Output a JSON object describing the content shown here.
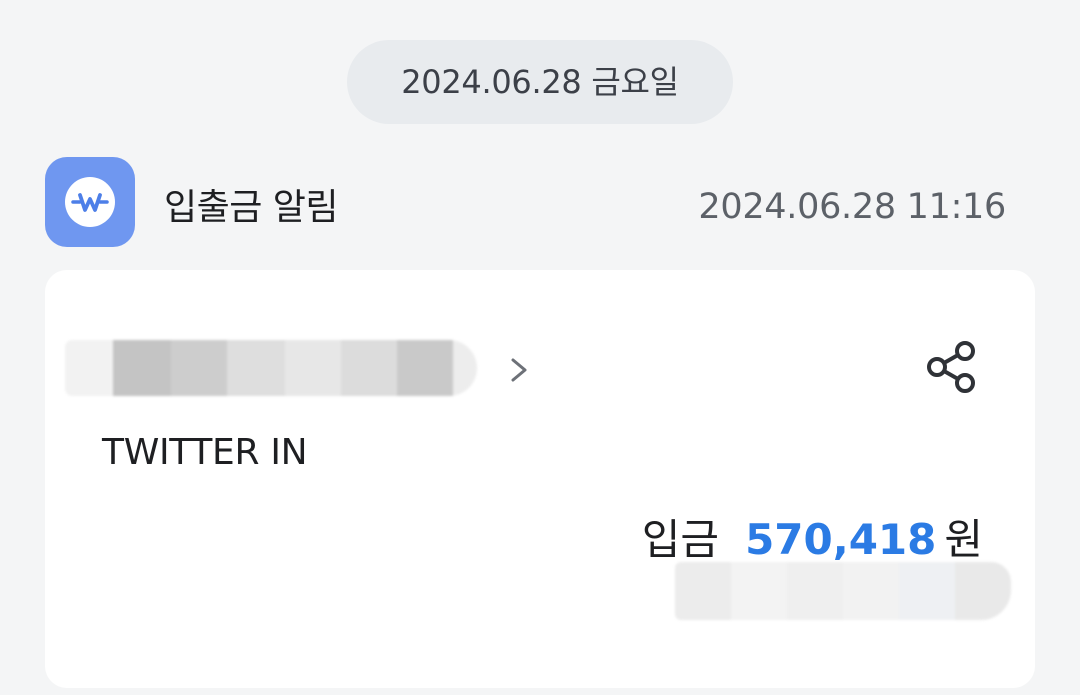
{
  "date_divider": "2024.06.28 금요일",
  "notification": {
    "app_name": "입출금 알림",
    "timestamp": "2024.06.28 11:16",
    "app_icon": "w-logo-icon"
  },
  "transaction": {
    "memo": "TWITTER IN",
    "type_label": "입금",
    "amount": "570,418",
    "currency": "원",
    "amount_color": "#2b7be4"
  },
  "colors": {
    "background": "#f4f5f6",
    "app_icon_bg": "#6f97f0",
    "date_pill_bg": "#e8ebee"
  }
}
